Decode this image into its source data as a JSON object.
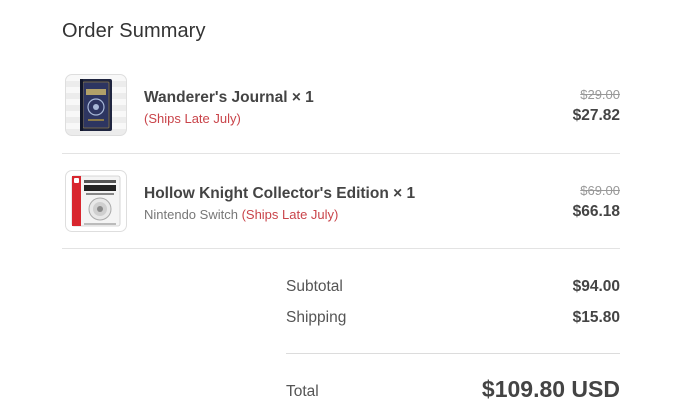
{
  "summary": {
    "title": "Order Summary"
  },
  "items": [
    {
      "name": "Wanderer's Journal × 1",
      "variant": "",
      "shipping_note": "(Ships Late July)",
      "original_price": "$29.00",
      "price": "$27.82",
      "thumbnail_icon": "book-cover-image"
    },
    {
      "name": "Hollow Knight Collector's Edition × 1",
      "variant": "Nintendo Switch ",
      "shipping_note": "(Ships Late July)",
      "original_price": "$69.00",
      "price": "$66.18",
      "thumbnail_icon": "game-box-image"
    }
  ],
  "totals": {
    "subtotal_label": "Subtotal",
    "subtotal_value": "$94.00",
    "shipping_label": "Shipping",
    "shipping_value": "$15.80",
    "total_label": "Total",
    "total_value": "$109.80 USD"
  },
  "colors": {
    "shipping_note": "#c9444a",
    "text_primary": "#444444",
    "text_muted": "#999999"
  }
}
